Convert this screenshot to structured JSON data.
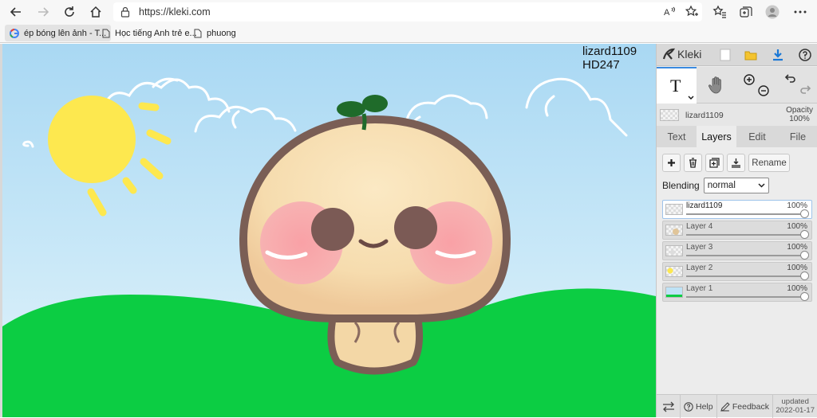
{
  "browser": {
    "url": "https://kleki.com",
    "read_aloud_icon": "read-aloud-icon",
    "bookmarks": [
      {
        "label": "ép bóng lên ảnh - T..."
      },
      {
        "label": "Học tiếng Anh trẻ e..."
      },
      {
        "label": "phuong"
      }
    ]
  },
  "canvas": {
    "signature_line1": "lizard1109",
    "signature_line2": "HD247"
  },
  "panel": {
    "logo_text": "Kleki",
    "current_layer_name": "lizard1109",
    "opacity_label": "Opacity",
    "opacity_value": "100%",
    "tabs": [
      "Text",
      "Layers",
      "Edit",
      "File"
    ],
    "rename_label": "Rename",
    "blending_label": "Blending",
    "blending_value": "normal",
    "layers": [
      {
        "name": "lizard1109",
        "opacity": "100%",
        "active": true
      },
      {
        "name": "Layer 4",
        "opacity": "100%",
        "active": false
      },
      {
        "name": "Layer 3",
        "opacity": "100%",
        "active": false
      },
      {
        "name": "Layer 2",
        "opacity": "100%",
        "active": false
      },
      {
        "name": "Layer 1",
        "opacity": "100%",
        "active": false
      }
    ],
    "help_label": "Help",
    "feedback_label": "Feedback",
    "updated_label": "updated",
    "updated_date": "2022-01-17"
  },
  "colors": {
    "sky": "#bfe3f6",
    "grass": "#0ccd43",
    "sun": "#fde84f",
    "accent": "#3a8ae0"
  }
}
